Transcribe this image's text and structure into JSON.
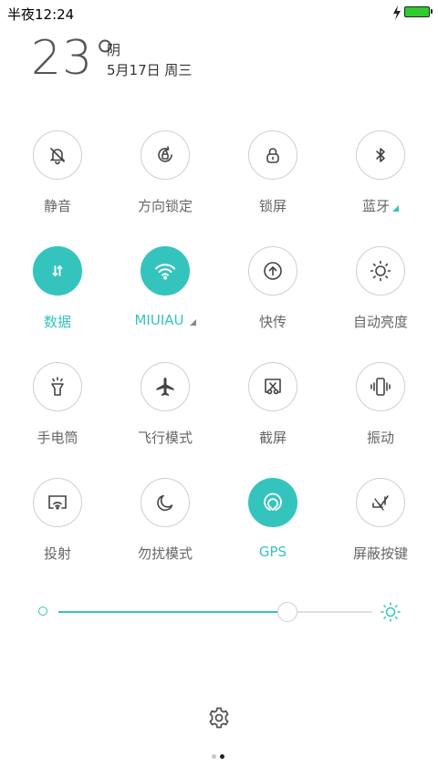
{
  "status_bar": {
    "time": "半夜12:24",
    "battery_level": 1.0,
    "battery_color": "#2ecc2e",
    "charging_icon": "lightning-icon"
  },
  "weather": {
    "temperature": "23°",
    "condition": "阴",
    "date": "5月17日 周三"
  },
  "accent_color": "#35c4bd",
  "tiles": [
    {
      "id": "mute",
      "label": "静音",
      "icon": "bell-off-icon",
      "active": false
    },
    {
      "id": "rotation-lock",
      "label": "方向锁定",
      "icon": "rotation-lock-icon",
      "active": false
    },
    {
      "id": "lock-screen",
      "label": "锁屏",
      "icon": "lock-icon",
      "active": false
    },
    {
      "id": "bluetooth",
      "label": "蓝牙",
      "icon": "bluetooth-icon",
      "active": false,
      "has_menu": true
    },
    {
      "id": "data",
      "label": "数据",
      "icon": "data-transfer-icon",
      "active": true
    },
    {
      "id": "wifi",
      "label": "MIUIAU",
      "icon": "wifi-icon",
      "active": true,
      "has_menu": true
    },
    {
      "id": "quick-share",
      "label": "快传",
      "icon": "upload-icon",
      "active": false
    },
    {
      "id": "auto-brightness",
      "label": "自动亮度",
      "icon": "sun-icon",
      "active": false
    },
    {
      "id": "flashlight",
      "label": "手电筒",
      "icon": "flashlight-icon",
      "active": false
    },
    {
      "id": "airplane",
      "label": "飞行模式",
      "icon": "airplane-icon",
      "active": false
    },
    {
      "id": "screenshot",
      "label": "截屏",
      "icon": "scissors-icon",
      "active": false
    },
    {
      "id": "vibrate",
      "label": "振动",
      "icon": "vibrate-icon",
      "active": false
    },
    {
      "id": "cast",
      "label": "投射",
      "icon": "cast-icon",
      "active": false
    },
    {
      "id": "dnd",
      "label": "勿扰模式",
      "icon": "moon-icon",
      "active": false
    },
    {
      "id": "gps",
      "label": "GPS",
      "icon": "location-icon",
      "active": true
    },
    {
      "id": "hide-keys",
      "label": "屏蔽按键",
      "icon": "block-keys-icon",
      "active": false
    }
  ],
  "brightness": {
    "value": 0.73,
    "min_icon": "dim-circle-icon",
    "max_icon": "sun-icon"
  },
  "settings_icon": "gear-icon",
  "pager": {
    "pages": 2,
    "current": 1
  }
}
